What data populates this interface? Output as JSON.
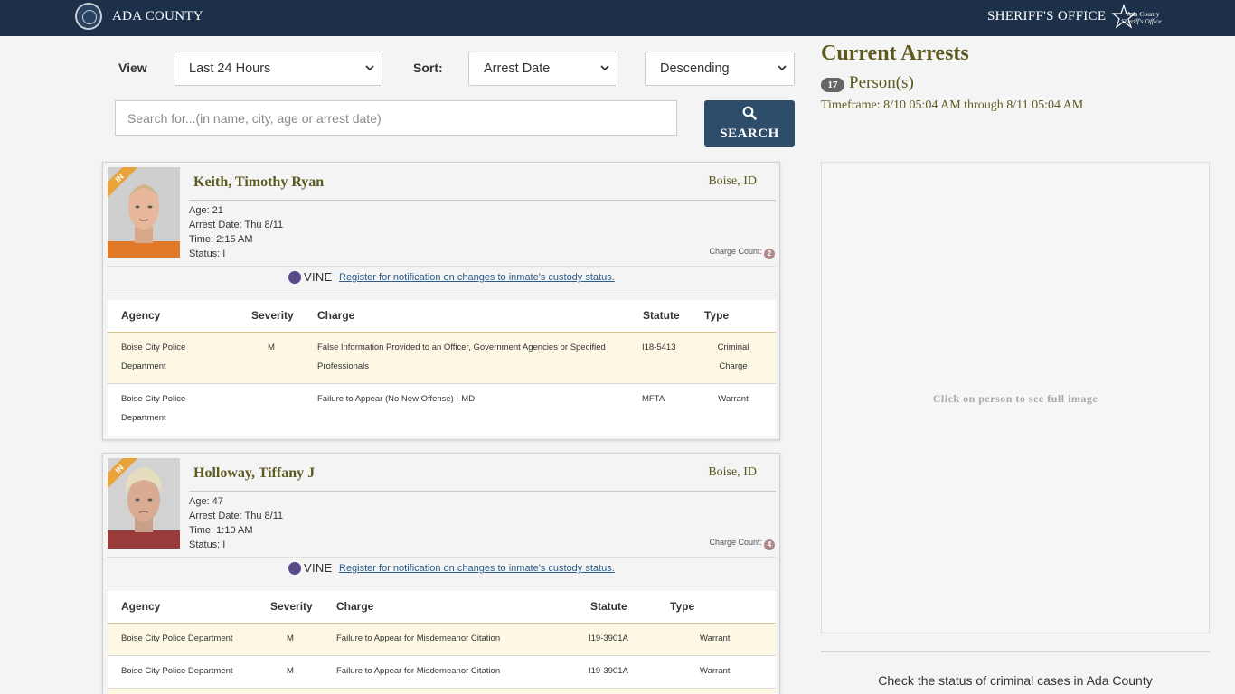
{
  "header": {
    "county_title": "ADA COUNTY",
    "sheriff_title": "SHERIFF'S OFFICE",
    "logo_line1": "Ada County",
    "logo_line2": "Sheriff's Office",
    "bar_color": "#1c3149"
  },
  "filters": {
    "view_label": "View",
    "view_value": "Last 24 Hours",
    "sort_label": "Sort:",
    "sort_value": "Arrest Date",
    "order_value": "Descending",
    "search_placeholder": "Search for...(in name, city, age or arrest date)",
    "search_button": "SEARCH"
  },
  "arrests": [
    {
      "ribbon": "IN",
      "name": "Keith, Timothy Ryan",
      "city": "Boise, ID",
      "age": "Age: 21",
      "arrest_date": "Arrest Date: Thu 8/11",
      "time": "Time: 2:15 AM",
      "status": "Status: I",
      "charge_count_label": "Charge Count:",
      "charge_count": "2",
      "vine_logo": "VINE",
      "vine_link": " Register for notification on changes to inmate's custody status.",
      "headers": {
        "agency": "Agency",
        "severity": "Severity",
        "charge": "Charge",
        "statute": "Statute",
        "type": "Type"
      },
      "charges": [
        {
          "agency": "Boise City Police Department",
          "severity": "M",
          "charge": "False Information Provided to an Officer, Government Agencies or Specified Professionals",
          "statute": "I18-5413",
          "type": "Criminal Charge"
        },
        {
          "agency": "Boise City Police Department",
          "severity": "",
          "charge": "Failure to Appear (No New Offense) - MD",
          "statute": "MFTA",
          "type": "Warrant"
        }
      ]
    },
    {
      "ribbon": "IN",
      "name": "Holloway, Tiffany J",
      "city": "Boise, ID",
      "age": "Age: 47",
      "arrest_date": "Arrest Date: Thu 8/11",
      "time": "Time: 1:10 AM",
      "status": "Status: I",
      "charge_count_label": "Charge Count:",
      "charge_count": "4",
      "vine_logo": "VINE",
      "vine_link": " Register for notification on changes to inmate's custody status.",
      "headers": {
        "agency": "Agency",
        "severity": "Severity",
        "charge": "Charge",
        "statute": "Statute",
        "type": "Type"
      },
      "charges": [
        {
          "agency": "Boise City Police Department",
          "severity": "M",
          "charge": "Failure to Appear for Misdemeanor Citation",
          "statute": "I19-3901A",
          "type": "Warrant"
        },
        {
          "agency": "Boise City Police Department",
          "severity": "M",
          "charge": "Failure to Appear for Misdemeanor Citation",
          "statute": "I19-3901A",
          "type": "Warrant"
        }
      ]
    }
  ],
  "summary": {
    "title": "Current Arrests",
    "count": "17",
    "persons_label": "Person(s)",
    "timeframe": "Timeframe: 8/10 05:04 AM through 8/11 05:04 AM",
    "preview_hint": "Click on person to see full image",
    "cases_text": "Check the status of criminal cases in Ada County"
  }
}
